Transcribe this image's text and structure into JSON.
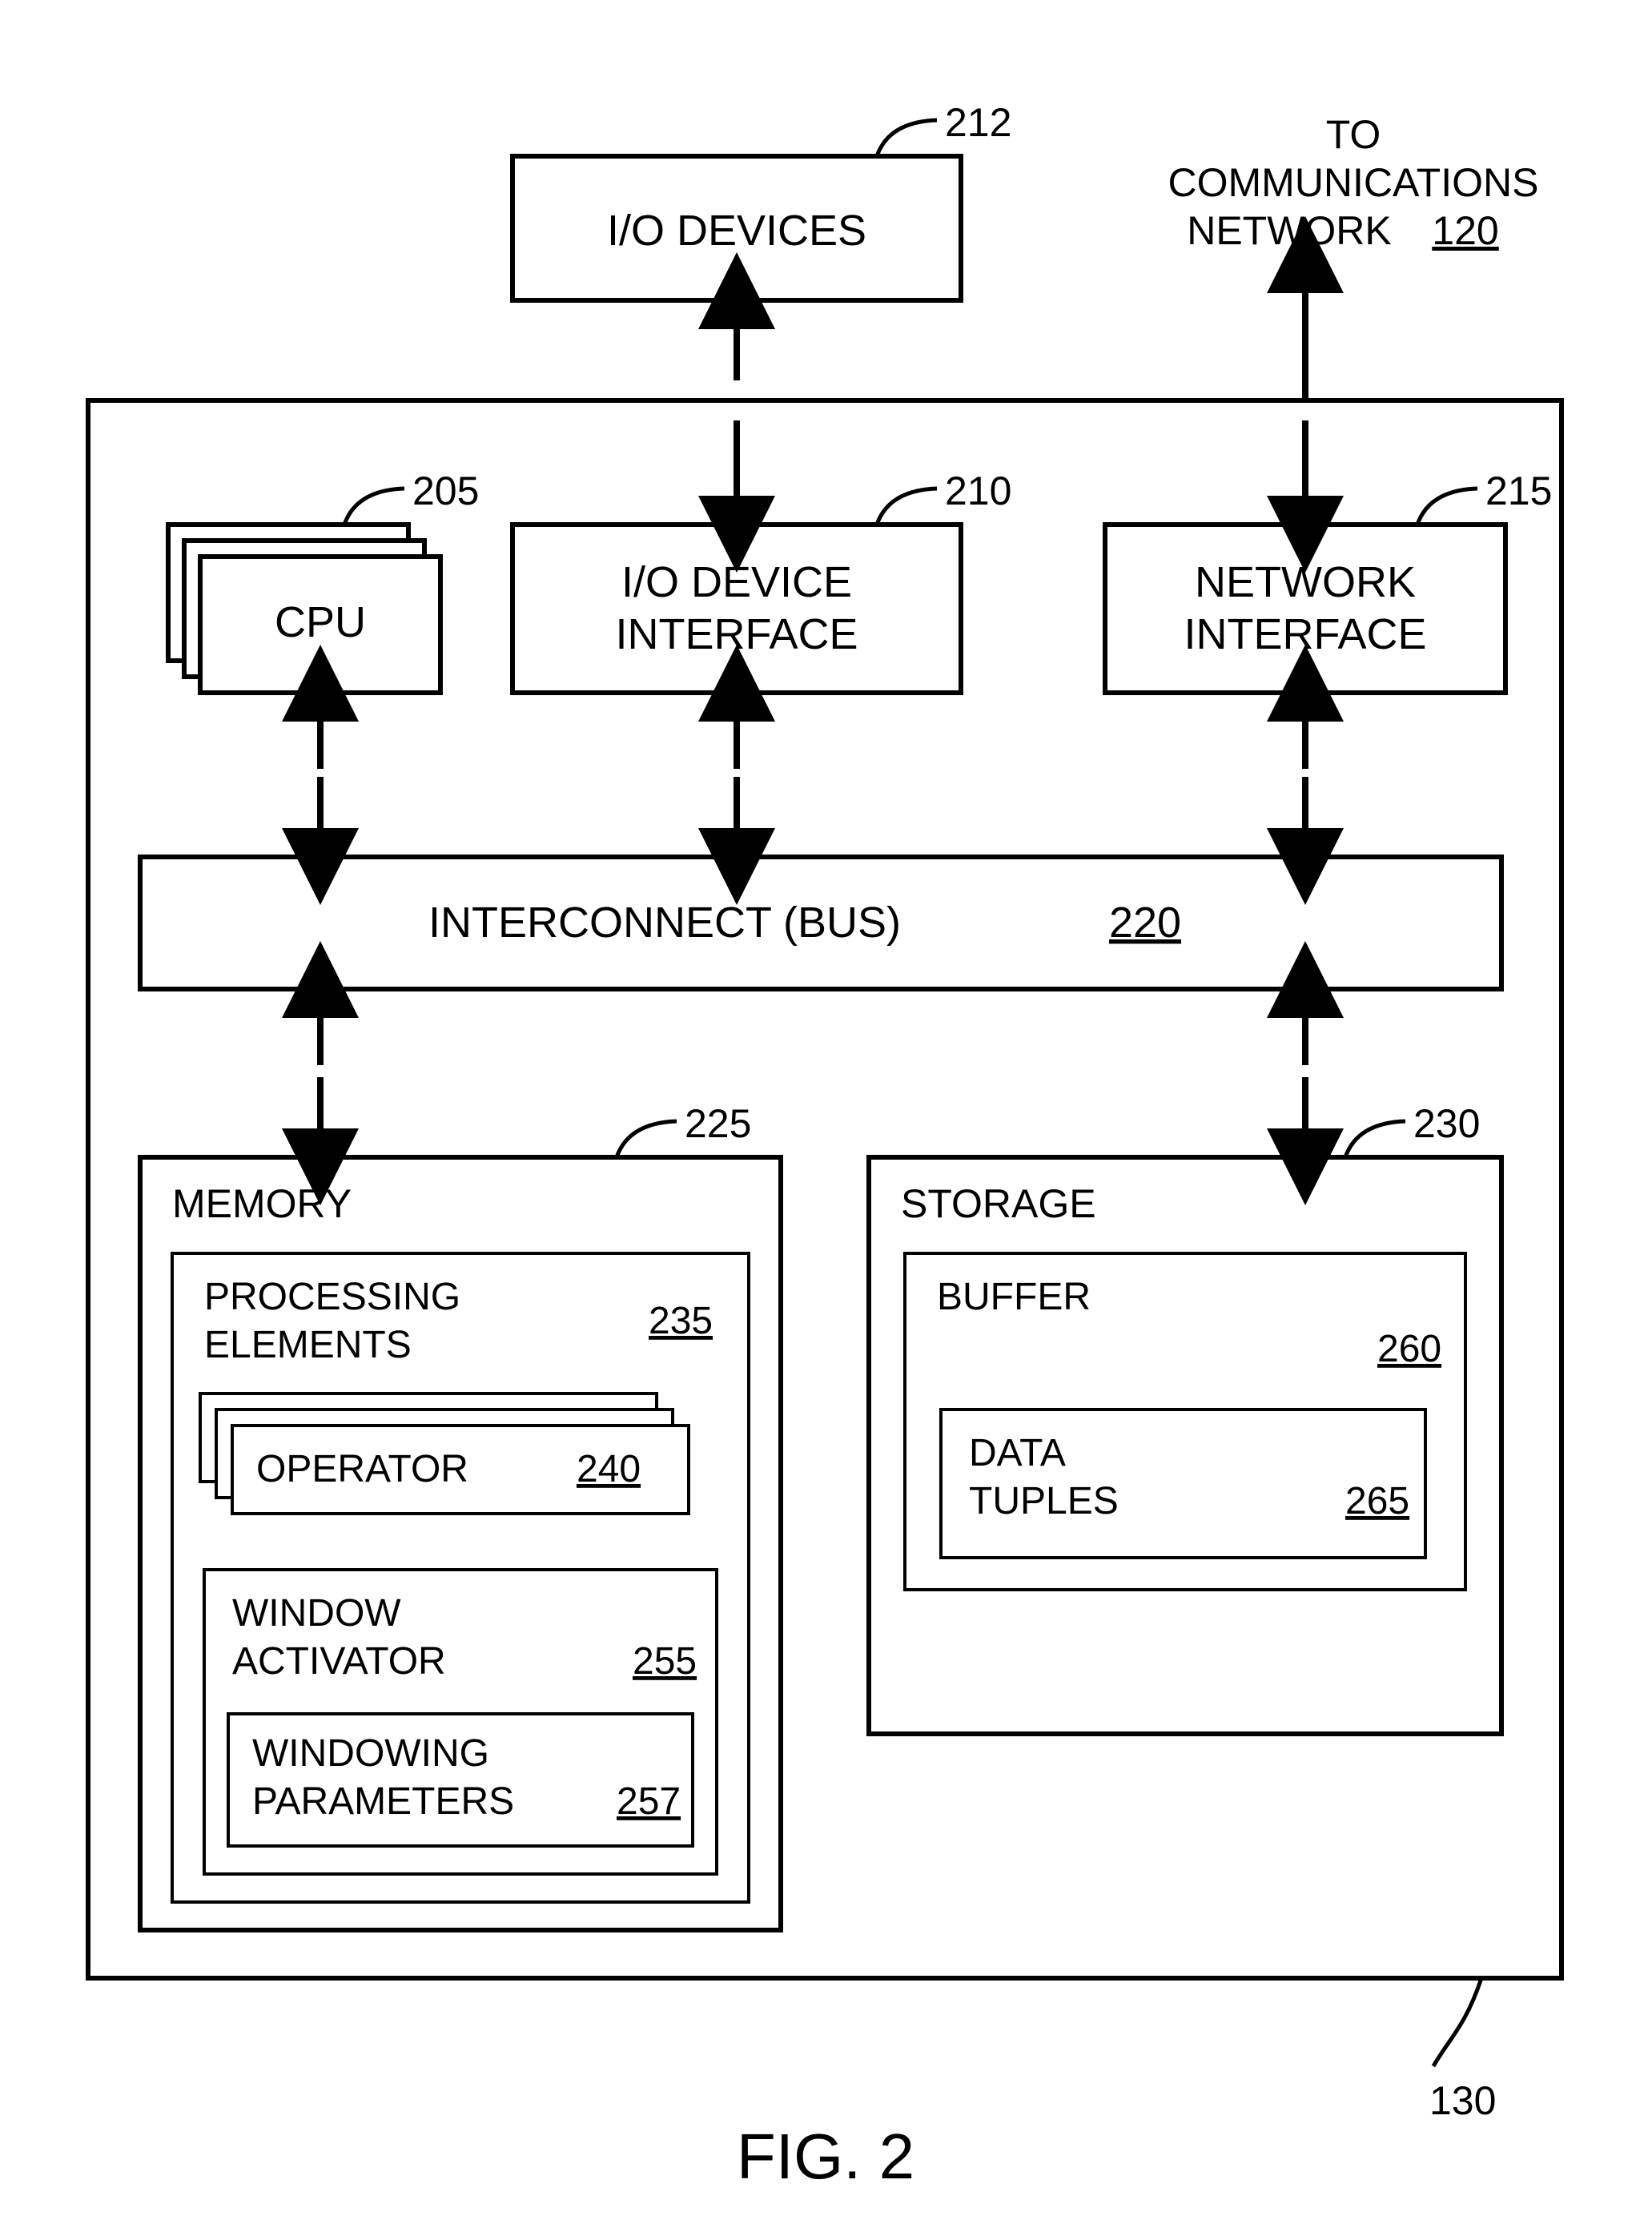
{
  "figure_caption": "FIG. 2",
  "external": {
    "io_devices": {
      "label": "I/O DEVICES",
      "ref": "212"
    },
    "comms_net": {
      "line1": "TO",
      "line2": "COMMUNICATIONS",
      "line3": "NETWORK",
      "ref": "120"
    }
  },
  "top_row": {
    "cpu": {
      "label": "CPU",
      "ref": "205"
    },
    "io_iface": {
      "line1": "I/O DEVICE",
      "line2": "INTERFACE",
      "ref": "210"
    },
    "net_iface": {
      "line1": "NETWORK",
      "line2": "INTERFACE",
      "ref": "215"
    }
  },
  "bus": {
    "label": "INTERCONNECT (BUS)",
    "ref": "220"
  },
  "memory": {
    "label": "MEMORY",
    "ref": "225",
    "processing_elements": {
      "line1": "PROCESSING",
      "line2": "ELEMENTS",
      "ref": "235"
    },
    "operator": {
      "label": "OPERATOR",
      "ref": "240"
    },
    "window_activator": {
      "line1": "WINDOW",
      "line2": "ACTIVATOR",
      "ref": "255"
    },
    "windowing_params": {
      "line1": "WINDOWING",
      "line2": "PARAMETERS",
      "ref": "257"
    }
  },
  "storage": {
    "label": "STORAGE",
    "ref": "230",
    "buffer": {
      "label": "BUFFER",
      "ref": "260"
    },
    "data_tuples": {
      "line1": "DATA",
      "line2": "TUPLES",
      "ref": "265"
    }
  },
  "node_ref": "130"
}
